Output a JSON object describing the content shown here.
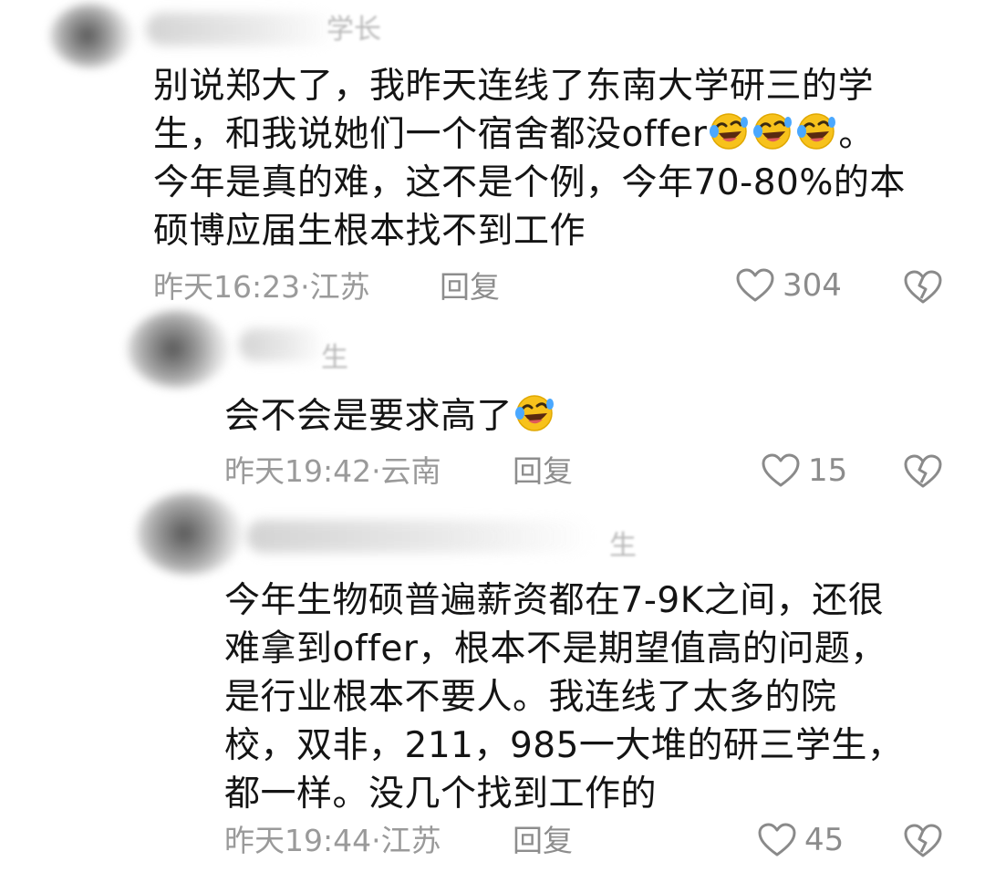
{
  "comments": [
    {
      "name_visible": "学长",
      "lines": [
        "别说郑大了，我昨天连线了东南大学研三的学",
        "生，和我说她们一个宿舍都没offer",
        "今年是真的难，这不是个例，今年70-80%的本",
        "硕博应届生根本找不到工作"
      ],
      "line2_suffix": "。",
      "time": "昨天16:23·江苏",
      "reply_label": "回复",
      "likes": "304"
    },
    {
      "name_visible": "生",
      "lines": [
        "会不会是要求高了"
      ],
      "time": "昨天19:42·云南",
      "reply_label": "回复",
      "likes": "15"
    },
    {
      "name_visible": "生",
      "lines": [
        "今年生物硕普遍薪资都在7-9K之间，还很",
        "难拿到offer，根本不是期望值高的问题，",
        "是行业根本不要人。我连线了太多的院",
        "校，双非，211，985一大堆的研三学生，",
        "都一样。没几个找到工作的"
      ],
      "time": "昨天19:44·江苏",
      "reply_label": "回复",
      "likes": "45"
    }
  ],
  "icons": {
    "emoji": "rolling-on-floor-laughing-emoji",
    "like": "heart-outline-icon",
    "dislike": "broken-heart-icon"
  },
  "colors": {
    "text": "#141414",
    "meta": "#9a9a9a",
    "emoji_face": "#f7c21c"
  }
}
